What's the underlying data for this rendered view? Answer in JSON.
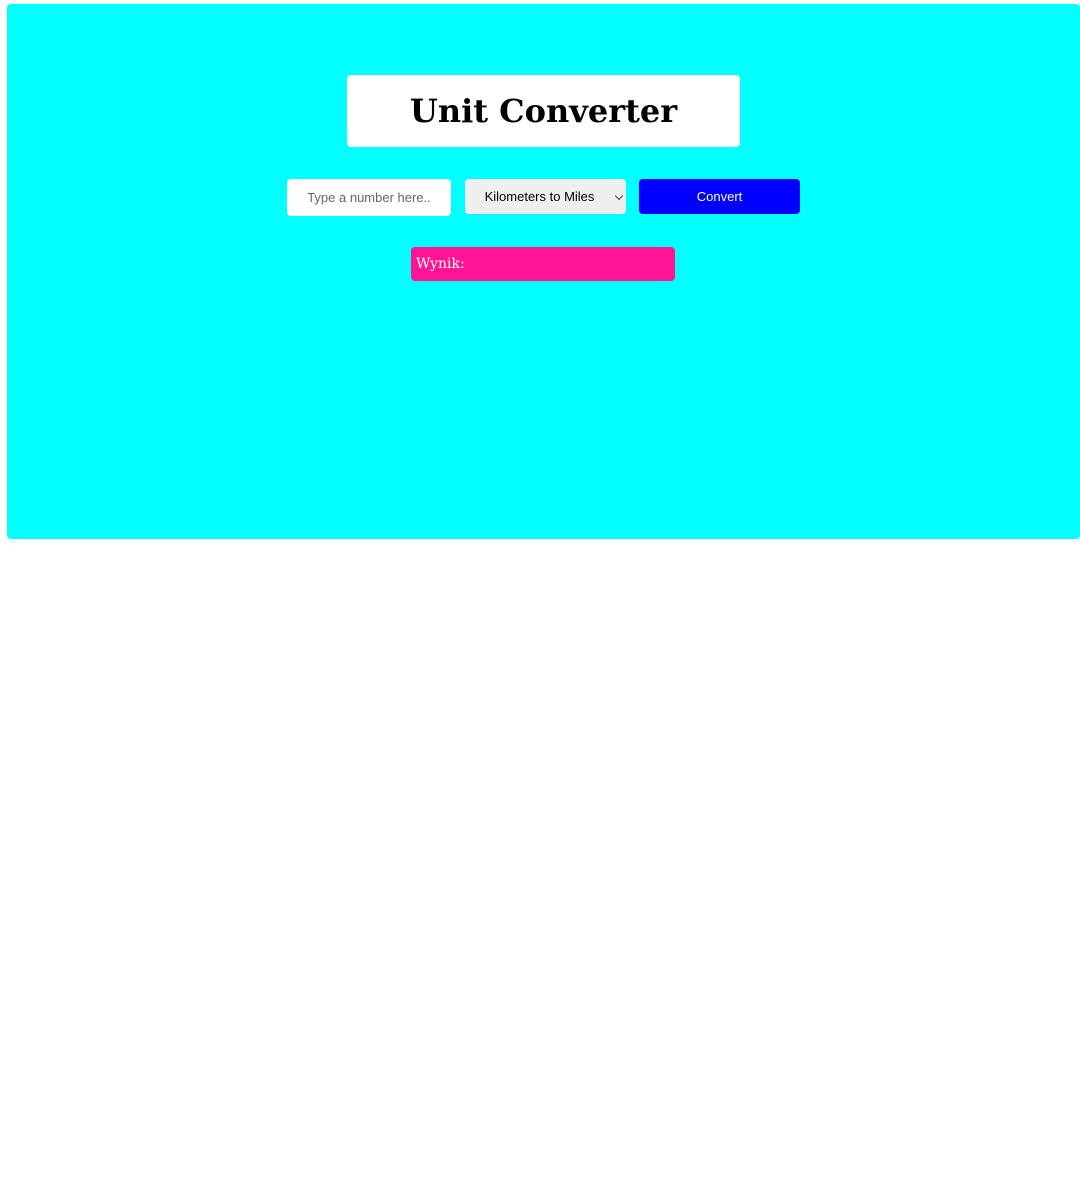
{
  "app": {
    "title": "Unit Converter"
  },
  "converter": {
    "input_placeholder": "Type a number here..",
    "input_value": "",
    "unit_selected": "Kilometers to Miles",
    "convert_label": "Convert"
  },
  "result": {
    "label": "Wynik:"
  },
  "colors": {
    "panel_background": "#00ffff",
    "title_background": "#ffffff",
    "convert_button": "#0000ff",
    "result_background": "#ff1493"
  },
  "icons": {
    "select_arrow": "chevron-down-icon"
  }
}
